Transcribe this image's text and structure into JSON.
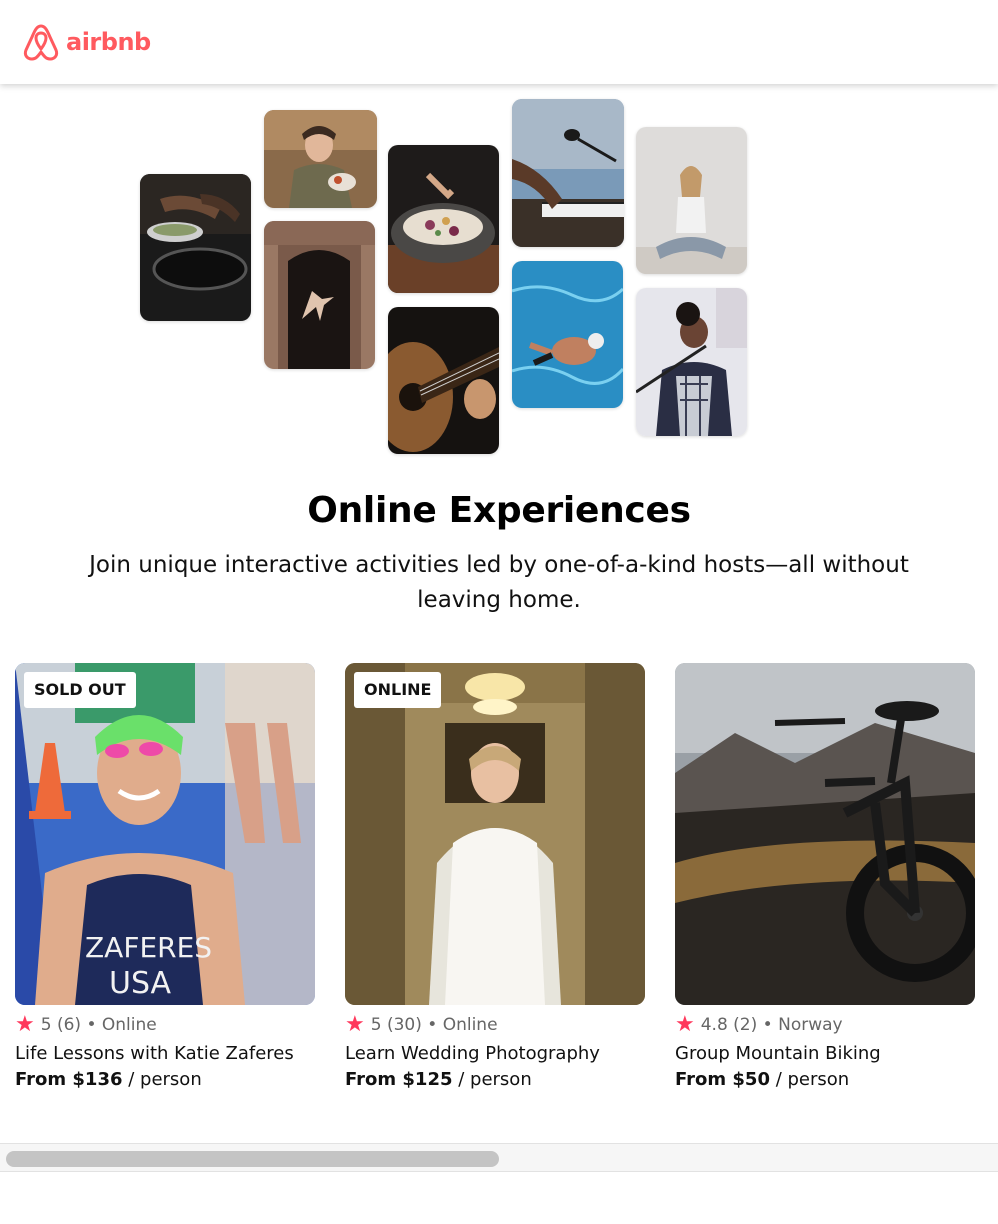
{
  "header": {
    "logo_text": "airbnb",
    "logo_icon": "airbnb-belo-icon",
    "brand_color": "#FF5A5F"
  },
  "hero": {
    "title": "Online Experiences",
    "subtitle": "Join unique interactive activities led by one-of-a-kind hosts—all without leaving home."
  },
  "cards": [
    {
      "badge": "SOLD OUT",
      "rating": "5 (6)",
      "location": "• Online",
      "title": "Life Lessons with Katie Zaferes",
      "price": "From $136",
      "per": " / person"
    },
    {
      "badge": "ONLINE",
      "rating": "5 (30)",
      "location": "• Online",
      "title": "Learn Wedding Photography",
      "price": "From $125",
      "per": " / person"
    },
    {
      "badge": "",
      "rating": "4.8 (2)",
      "location": "• Norway",
      "title": "Group Mountain Biking",
      "price": "From $50",
      "per": " / person"
    }
  ],
  "star_color": "#FF385C"
}
